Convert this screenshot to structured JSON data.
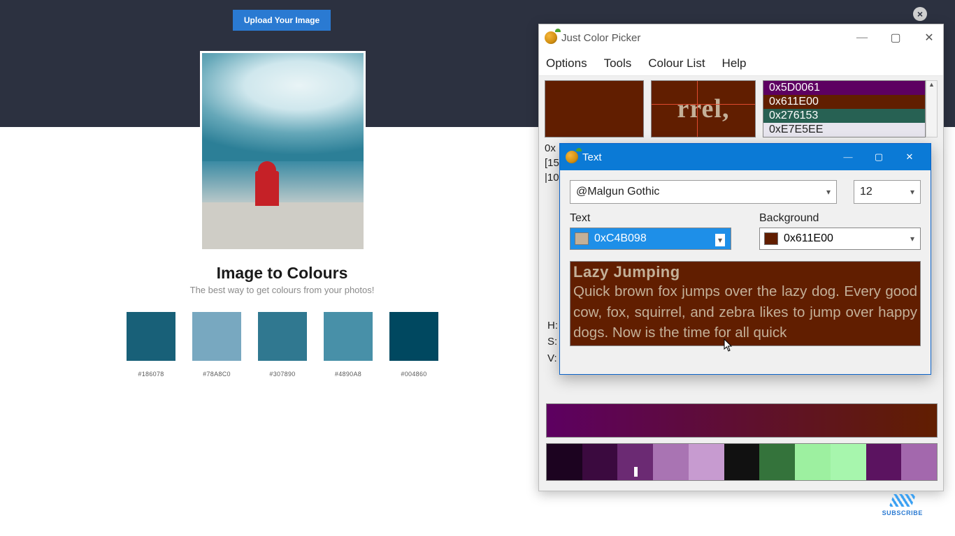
{
  "web": {
    "upload_label": "Upload Your Image",
    "title": "Image to Colours",
    "subtitle": "The best way to get colours from your photos!",
    "palette": [
      {
        "hex": "#186078"
      },
      {
        "hex": "#78A8C0"
      },
      {
        "hex": "#307890"
      },
      {
        "hex": "#4890A8"
      },
      {
        "hex": "#004860"
      }
    ],
    "subscribe_label": "SUBSCRIBE"
  },
  "jcp": {
    "title": "Just Color Picker",
    "menu": [
      "Options",
      "Tools",
      "Colour List",
      "Help"
    ],
    "sample_color": "#611E00",
    "zoom_fragment": "rrel,",
    "history": [
      {
        "code": "0x5D0061",
        "bg": "#5D0061",
        "fg": "#ffffff"
      },
      {
        "code": "0x611E00",
        "bg": "#611E00",
        "fg": "#ffffff"
      },
      {
        "code": "0x276153",
        "bg": "#276153",
        "fg": "#ffffff"
      },
      {
        "code": "0xE7E5EE",
        "bg": "#E7E5EE",
        "fg": "#222222"
      }
    ],
    "readouts": [
      "0x",
      "[15",
      "|10"
    ],
    "hsv_labels": [
      "H:",
      "S:",
      "V:"
    ],
    "row_visible": "H",
    "gradient": {
      "from": "#5D0061",
      "to": "#611E00"
    },
    "variants": [
      "#1c0320",
      "#3b0a3f",
      "#6b2a73",
      "#a974b3",
      "#c79bd0",
      "#111111",
      "#34733b",
      "#9df0a0",
      "#a7f6ad",
      "#5b1360",
      "#a368ad"
    ],
    "variant_marked_index": 2
  },
  "txtwin": {
    "title": "Text",
    "font_value": "@Malgun Gothic",
    "size_value": "12",
    "text_label": "Text",
    "text_value": "0xC4B098",
    "text_swatch": "#C4B098",
    "background_label": "Background",
    "background_value": "0x611E00",
    "background_swatch": "#611E00",
    "preview_heading": "Lazy Jumping",
    "preview_body": "Quick brown fox jumps over the lazy dog. Every good cow, fox, squirrel, and zebra likes to jump over happy dogs. Now is the time for all quick"
  }
}
